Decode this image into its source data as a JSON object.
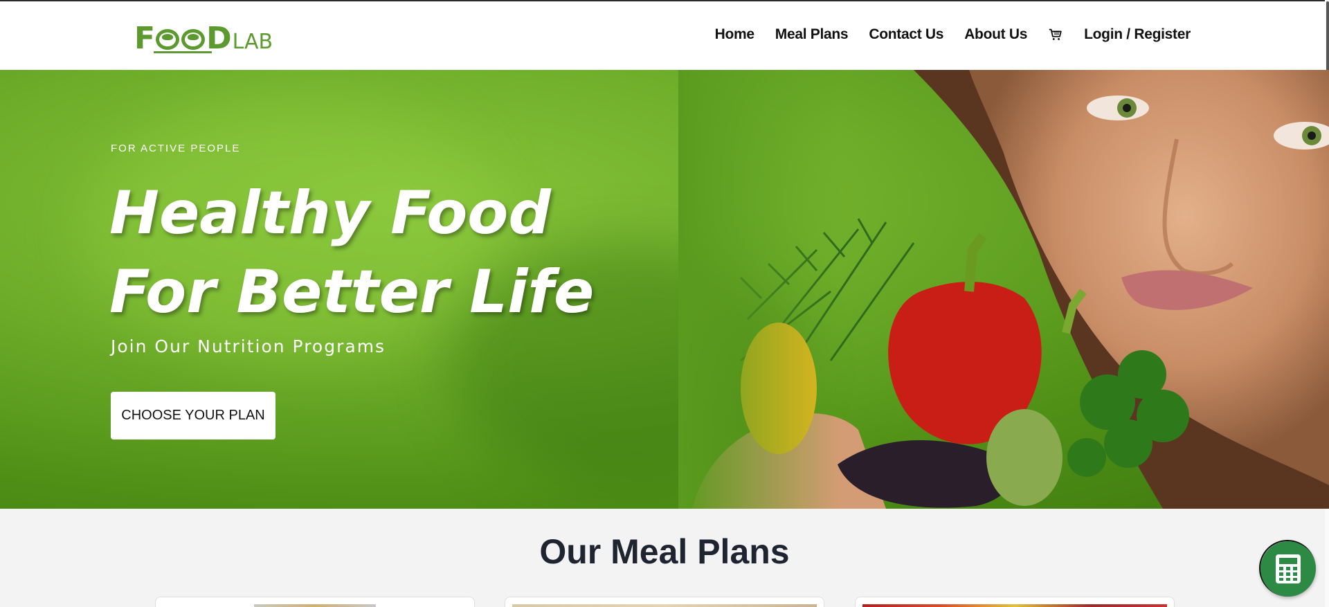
{
  "header": {
    "logo": {
      "big_text": "F",
      "big_text_end": "D",
      "small_text": "LAB"
    },
    "nav": [
      {
        "label": "Home"
      },
      {
        "label": "Meal Plans"
      },
      {
        "label": "Contact Us"
      },
      {
        "label": "About Us"
      },
      {
        "icon": "cart-icon"
      },
      {
        "label": "Login / Register"
      }
    ]
  },
  "hero": {
    "eyebrow": "FOR ACTIVE PEOPLE",
    "headline_line1": "Healthy Food",
    "headline_line2": "For Better Life",
    "subheadline": "Join Our Nutrition Programs",
    "cta_label": "CHOOSE YOUR PLAN"
  },
  "section": {
    "title": "Our Meal Plans"
  },
  "floating": {
    "icon": "calculator-icon"
  },
  "colors": {
    "brand_green": "#5c9a2f",
    "hero_green": "#6fae2a",
    "calc_button": "#2d8a45"
  }
}
